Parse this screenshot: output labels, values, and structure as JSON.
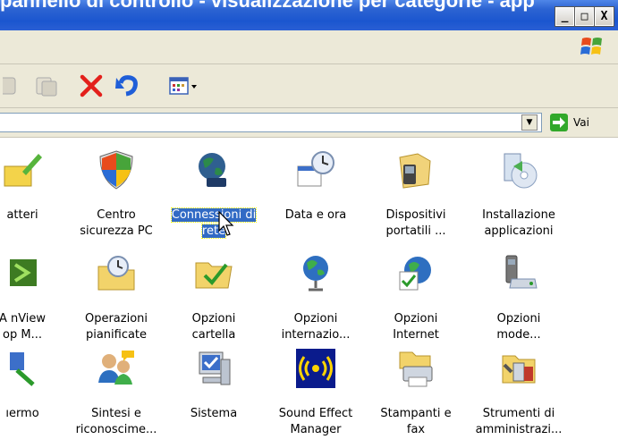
{
  "window": {
    "title_fragment": "pannello di controllo - visualizzazione per categorie - app",
    "min_label": "_",
    "max_label": "□",
    "close_label": "X"
  },
  "address": {
    "go_label": "Vai",
    "dropdown_icon": "dropdown-arrow-icon"
  },
  "toolbar": {
    "icons": [
      "move-to-icon",
      "copy-to-icon",
      "delete-icon",
      "undo-icon",
      "views-icon"
    ]
  },
  "items": [
    {
      "row": 0,
      "col": 0,
      "label_line1": "atteri",
      "label_line2": "",
      "icon": "brush-icon"
    },
    {
      "row": 0,
      "col": 1,
      "label_line1": "Centro",
      "label_line2": "sicurezza PC",
      "icon": "shield-icon"
    },
    {
      "row": 0,
      "col": 2,
      "label_line1": "Connessioni di",
      "label_line2": "rete",
      "icon": "network-globe-icon",
      "selected": true
    },
    {
      "row": 0,
      "col": 3,
      "label_line1": "Data e ora",
      "label_line2": "",
      "icon": "calendar-clock-icon"
    },
    {
      "row": 0,
      "col": 4,
      "label_line1": "Dispositivi",
      "label_line2": "portatili ...",
      "icon": "portable-devices-icon"
    },
    {
      "row": 0,
      "col": 5,
      "label_line1": "Installazione",
      "label_line2": "applicazioni",
      "icon": "install-cd-icon"
    },
    {
      "row": 1,
      "col": 0,
      "label_line1": "A nView",
      "label_line2": "op M...",
      "icon": "nview-icon"
    },
    {
      "row": 1,
      "col": 1,
      "label_line1": "Operazioni",
      "label_line2": "pianificate",
      "icon": "scheduled-tasks-icon"
    },
    {
      "row": 1,
      "col": 2,
      "label_line1": "Opzioni",
      "label_line2": "cartella",
      "icon": "folder-options-icon"
    },
    {
      "row": 1,
      "col": 3,
      "label_line1": "Opzioni",
      "label_line2": "internazio...",
      "icon": "globe-stand-icon"
    },
    {
      "row": 1,
      "col": 4,
      "label_line1": "Opzioni",
      "label_line2": "Internet",
      "icon": "internet-globe-icon"
    },
    {
      "row": 1,
      "col": 5,
      "label_line1": "Opzioni",
      "label_line2": "mode...",
      "icon": "modem-icon"
    },
    {
      "row": 2,
      "col": 0,
      "label_line1": "ıermo",
      "label_line2": "",
      "icon": "screen-icon"
    },
    {
      "row": 2,
      "col": 1,
      "label_line1": "Sintesi e",
      "label_line2": "riconoscime...",
      "icon": "speech-icon"
    },
    {
      "row": 2,
      "col": 2,
      "label_line1": "Sistema",
      "label_line2": "",
      "icon": "system-icon"
    },
    {
      "row": 2,
      "col": 3,
      "label_line1": "Sound Effect",
      "label_line2": "Manager",
      "icon": "sound-effect-icon"
    },
    {
      "row": 2,
      "col": 4,
      "label_line1": "Stampanti e",
      "label_line2": "fax",
      "icon": "printer-icon"
    },
    {
      "row": 2,
      "col": 5,
      "label_line1": "Strumenti di",
      "label_line2": "amministrazi...",
      "icon": "admin-tools-icon"
    }
  ],
  "colors": {
    "titlebar": "#2c63d2",
    "chrome": "#ece9d8",
    "selection": "#316ac5"
  }
}
